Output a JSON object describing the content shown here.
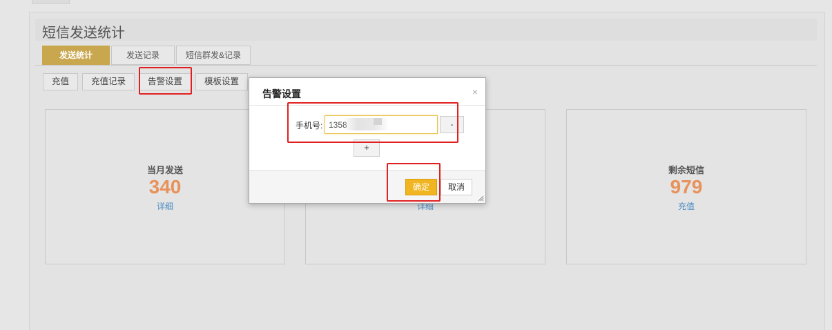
{
  "page": {
    "title": "短信发送统计"
  },
  "tabs": [
    {
      "label": "发送统计",
      "active": true
    },
    {
      "label": "发送记录",
      "active": false
    },
    {
      "label": "短信群发&记录",
      "active": false
    }
  ],
  "subbuttons": [
    "充值",
    "充值记录",
    "告警设置",
    "模板设置"
  ],
  "stats": [
    {
      "label": "当月发送",
      "value": "340",
      "link": "详细"
    },
    {
      "label": "",
      "value": "",
      "link": "详细"
    },
    {
      "label": "剩余短信",
      "value": "979",
      "link": "充值"
    }
  ],
  "modal": {
    "title": "告警设置",
    "close_icon": "×",
    "phone_label": "手机号:",
    "phone_value": "1358",
    "minus_label": "-",
    "plus_label": "+",
    "ok_label": "确定",
    "cancel_label": "取消"
  },
  "colors": {
    "accent": "#c9a74f",
    "stat_value": "#e8925a",
    "link": "#4a8bc2",
    "ok_button": "#f1b521",
    "highlight": "#e02020"
  }
}
